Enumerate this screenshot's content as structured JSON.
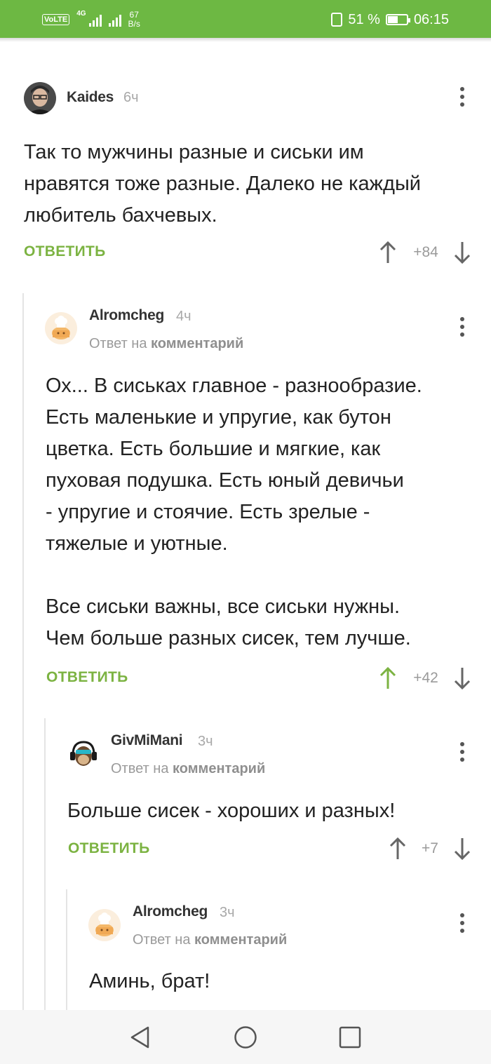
{
  "status_bar": {
    "volte": "VoLTE",
    "network": "4G",
    "speed_value": "67",
    "speed_unit": "B/s",
    "battery": "51 %",
    "time": "06:15"
  },
  "comments": [
    {
      "author": "Kaides",
      "time": "6ч",
      "text_lines": [
        "Так то мужчины разные и сиськи им",
        "нравятся тоже разные. Далеко не каждый",
        "любитель бахчевых."
      ],
      "reply_label": "ОТВЕТИТЬ",
      "score": "+84",
      "avatar_icon": "user-photo-avatar"
    },
    {
      "author": "Alromcheg",
      "time": "4ч",
      "reply_to_prefix": "Ответ на",
      "reply_to_link": "комментарий",
      "text_lines": [
        "Ох... В сиськах главное - разнообразие.",
        "Есть маленькие и упругие, как бутон",
        "цветка. Есть большие и мягкие, как",
        "пуховая подушка. Есть юный девичьи",
        "- упругие и стоячие. Есть зрелые -",
        "тяжелые и уютные.",
        "",
        "Все сиськи важны, все сиськи нужны.",
        "Чем больше разных сисек, тем лучше."
      ],
      "reply_label": "ОТВЕТИТЬ",
      "score": "+42",
      "upvoted": true,
      "avatar_icon": "chef-cake-avatar"
    },
    {
      "author": "GivMiMani",
      "time": "3ч",
      "reply_to_prefix": "Ответ на",
      "reply_to_link": "комментарий",
      "text_lines": [
        "Больше сисек - хороших и разных!"
      ],
      "reply_label": "ОТВЕТИТЬ",
      "score": "+7",
      "avatar_icon": "monkey-headphones-avatar"
    },
    {
      "author": "Alromcheg",
      "time": "3ч",
      "reply_to_prefix": "Ответ на",
      "reply_to_link": "комментарий",
      "text_lines": [
        "Аминь, брат!"
      ],
      "avatar_icon": "chef-cake-avatar"
    }
  ],
  "colors": {
    "accent": "#6db843",
    "reply": "#7cb342",
    "upvoted": "#7cb342",
    "text": "#222222"
  }
}
